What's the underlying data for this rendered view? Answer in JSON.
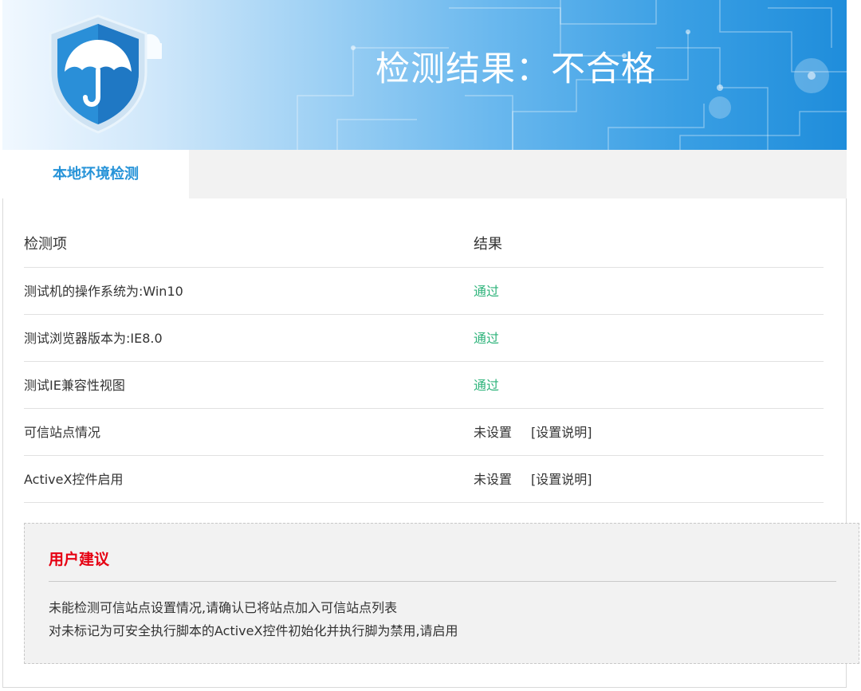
{
  "banner": {
    "title": "检测结果：不合格",
    "logo_icon": "shield-umbrella-icon"
  },
  "tabs": [
    {
      "label": "本地环境检测",
      "active": true
    }
  ],
  "table": {
    "headers": {
      "item": "检测项",
      "result": "结果"
    },
    "rows": [
      {
        "item": "测试机的操作系统为:Win10",
        "result": "通过",
        "status": "pass",
        "link": ""
      },
      {
        "item": "测试浏览器版本为:IE8.0",
        "result": "通过",
        "status": "pass",
        "link": ""
      },
      {
        "item": "测试IE兼容性视图",
        "result": "通过",
        "status": "pass",
        "link": ""
      },
      {
        "item": "可信站点情况",
        "result": "未设置",
        "status": "unset",
        "link": "[设置说明]"
      },
      {
        "item": "ActiveX控件启用",
        "result": "未设置",
        "status": "unset",
        "link": "[设置说明]"
      }
    ]
  },
  "advice": {
    "title": "用户建议",
    "lines": [
      "未能检测可信站点设置情况,请确认已将站点加入可信站点列表",
      "对未标记为可安全执行脚本的ActiveX控件初始化并执行脚为禁用,请启用"
    ]
  },
  "colors": {
    "accent": "#2693d8",
    "pass": "#2db37a",
    "warning": "#e60012"
  }
}
